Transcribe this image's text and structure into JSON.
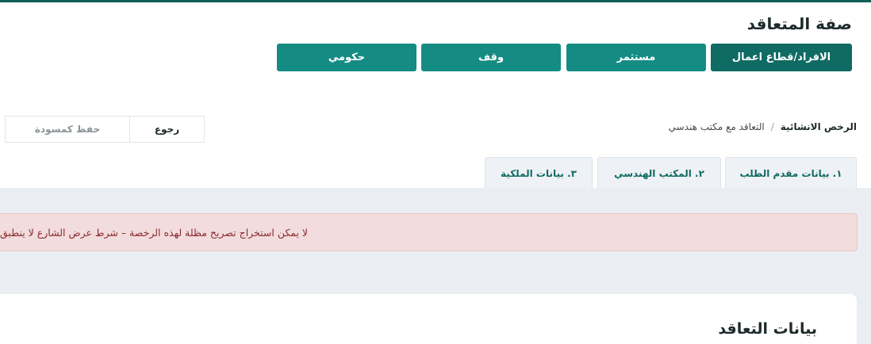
{
  "header": {
    "title": "صفة المتعاقد"
  },
  "contractor_types": {
    "individuals": "الافراد/قطاع اعمال",
    "investor": "مستثمر",
    "endowment": "وقف",
    "government": "حكومي"
  },
  "breadcrumb": {
    "root": "الرخص الانشائية",
    "separator": "/",
    "current": "التعاقد مع مكتب هندسي"
  },
  "actions": {
    "back": "رجوع",
    "save_draft": "حفظ كمسودة"
  },
  "tabs": {
    "applicant": "١. بيانات مقدم الطلب",
    "office": "٢. المكتب الهندسي",
    "property": "٣. بيانات الملكية"
  },
  "alert": {
    "message": "لا يمكن استخراج تصريح مظلة لهذه الرخصة – شرط عرض الشارع لا ينطبق"
  },
  "section": {
    "title": "بيانات التعاقد"
  },
  "colors": {
    "primary": "#148c84",
    "primary_active": "#0f6b64",
    "alert_bg": "#f2dcdd",
    "alert_text": "#8a2a2d"
  }
}
